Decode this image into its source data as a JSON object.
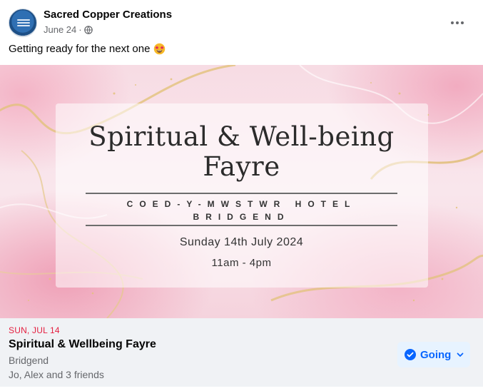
{
  "post": {
    "author": "Sacred Copper Creations",
    "date": "June 24",
    "separator": "·",
    "privacy_icon": "globe-icon",
    "more_icon": "more-horizontal-icon",
    "caption": "Getting ready for the next one",
    "caption_emoji": "star-struck-emoji-icon"
  },
  "event_image": {
    "title_line1": "Spiritual & Well-being",
    "title_line2": "Fayre",
    "venue_line1": "COED-Y-MWSTWR HOTEL",
    "venue_line2": "BRIDGEND",
    "date_text": "Sunday 14th July 2024",
    "time_text": "11am - 4pm"
  },
  "event": {
    "day": "SUN, JUL 14",
    "name": "Spiritual & Wellbeing Fayre",
    "location": "Bridgend",
    "friends": "Jo, Alex and 3 friends",
    "rsvp_label": "Going",
    "rsvp_icon": "check-circle-icon"
  },
  "colors": {
    "accent": "#0866ff",
    "date_red": "#e41e3f",
    "secondary_text": "#65676b",
    "footer_bg": "#f0f2f5",
    "button_bg": "#e7f3ff"
  }
}
